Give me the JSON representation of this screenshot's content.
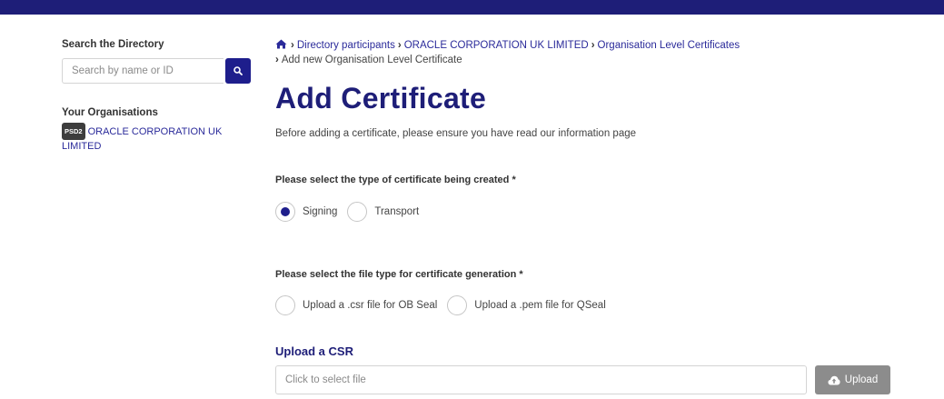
{
  "sidebar": {
    "search_heading": "Search the Directory",
    "search_placeholder": "Search by name or ID",
    "search_icon": "search-icon",
    "orgs_heading": "Your Organisations",
    "org_badge": "PSD2",
    "org_name": "ORACLE CORPORATION UK LIMITED"
  },
  "breadcrumb": {
    "home_icon": "home-icon",
    "items": [
      "Directory participants",
      "ORACLE CORPORATION UK LIMITED",
      "Organisation Level Certificates",
      "Add new Organisation Level Certificate"
    ]
  },
  "page": {
    "title": "Add Certificate",
    "intro": "Before adding a certificate, please ensure you have read our information page"
  },
  "cert_type": {
    "label": "Please select the type of certificate being created *",
    "options": [
      {
        "label": "Signing",
        "selected": true
      },
      {
        "label": "Transport",
        "selected": false
      }
    ]
  },
  "file_type": {
    "label": "Please select the file type for certificate generation *",
    "options": [
      {
        "label": "Upload a .csr file for OB Seal",
        "selected": false
      },
      {
        "label": "Upload a .pem file for QSeal",
        "selected": false
      }
    ]
  },
  "upload": {
    "heading": "Upload a CSR",
    "placeholder": "Click to select file",
    "button_label": "Upload",
    "button_icon": "cloud-upload-icon"
  },
  "colors": {
    "brand": "#1e1e78",
    "accent": "#1e1e8c",
    "link": "#2a2a9a",
    "button_disabled": "#8c8c8c"
  }
}
